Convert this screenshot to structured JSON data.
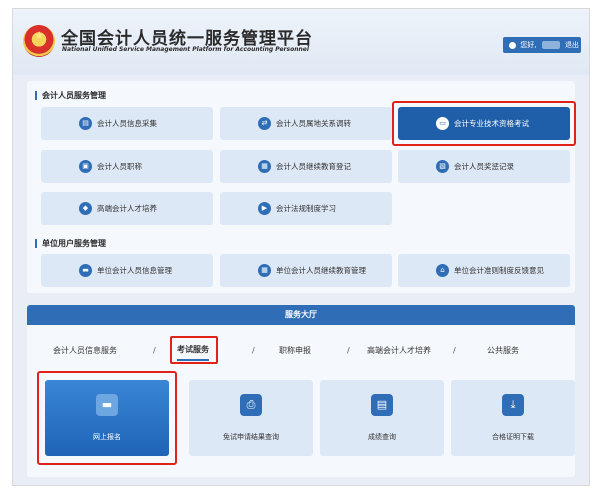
{
  "header": {
    "title": "全国会计人员统一服务管理平台",
    "subtitle": "National Unified Service Management Platform for Accounting Personnel",
    "greeting": "您好,",
    "logout": "退出"
  },
  "personal_section": {
    "title": "会计人员服务管理",
    "items": [
      {
        "label": "会计人员信息采集",
        "icon": "form-icon"
      },
      {
        "label": "会计人员属地关系调转",
        "icon": "transfer-icon"
      },
      {
        "label": "会计专业技术资格考试",
        "icon": "exam-icon",
        "active": true
      },
      {
        "label": "会计人员职称",
        "icon": "title-icon"
      },
      {
        "label": "会计人员继续教育登记",
        "icon": "edu-icon"
      },
      {
        "label": "会计人员奖惩记录",
        "icon": "record-icon"
      },
      {
        "label": "高端会计人才培养",
        "icon": "grad-cap-icon"
      },
      {
        "label": "会计法规制度学习",
        "icon": "play-icon"
      }
    ]
  },
  "unit_section": {
    "title": "单位用户服务管理",
    "items": [
      {
        "label": "单位会计人员信息管理",
        "icon": "card-icon"
      },
      {
        "label": "单位会计人员继续教育管理",
        "icon": "edu-icon"
      },
      {
        "label": "单位会计准则制度反馈意见",
        "icon": "home-icon"
      }
    ]
  },
  "service_hall": {
    "title": "服务大厅",
    "tabs": [
      {
        "label": "会计人员信息服务"
      },
      {
        "label": "考试服务",
        "active": true
      },
      {
        "label": "职称申报"
      },
      {
        "label": "高端会计人才培养"
      },
      {
        "label": "公共服务"
      }
    ],
    "separator": "/",
    "cards": [
      {
        "label": "网上报名",
        "icon": "register-icon",
        "active": true
      },
      {
        "label": "免试申请结果查询",
        "icon": "printer-icon"
      },
      {
        "label": "成绩查询",
        "icon": "score-icon"
      },
      {
        "label": "合格证明下载",
        "icon": "download-icon"
      }
    ]
  },
  "colors": {
    "accent": "#2f6db7",
    "active_dark": "#1f5ea8",
    "highlight": "#e0221a"
  }
}
